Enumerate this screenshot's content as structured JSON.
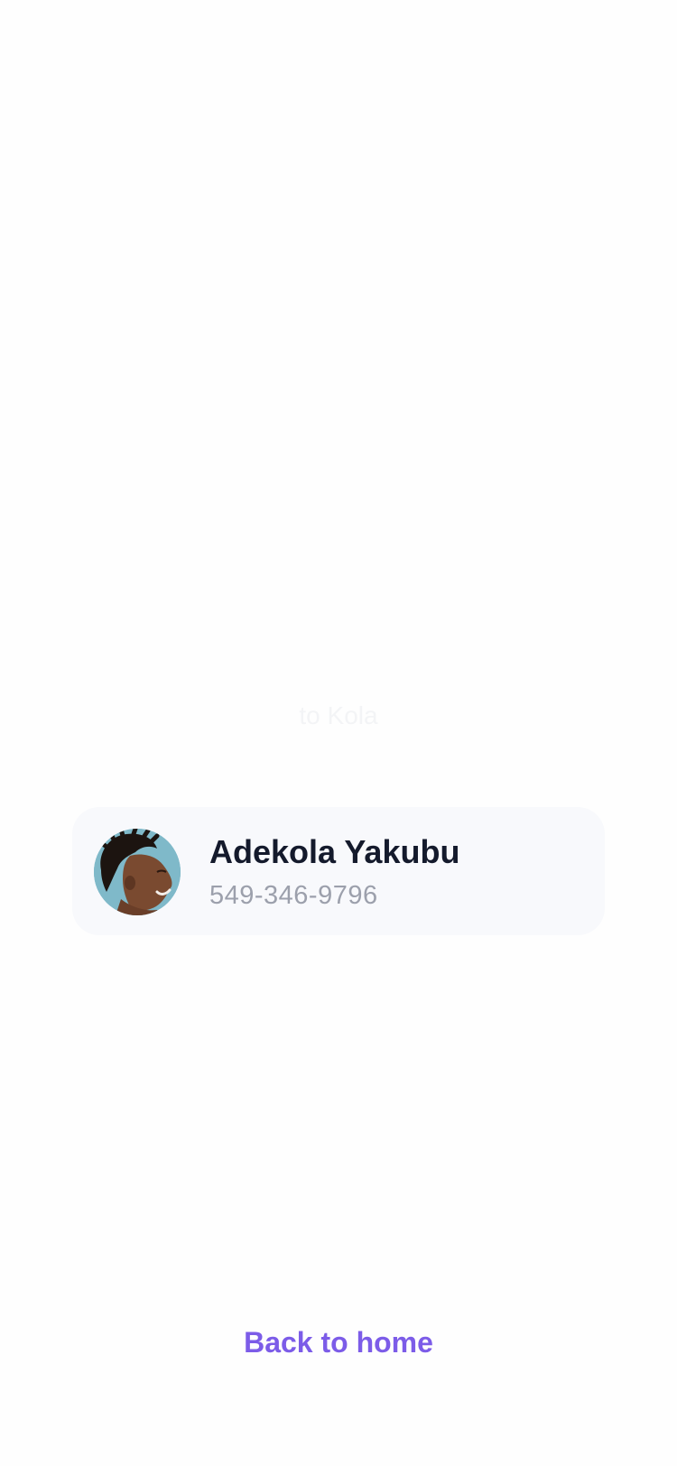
{
  "confirmation": {
    "subtitle": "to Kola"
  },
  "contact": {
    "name": "Adekola Yakubu",
    "phone": "549-346-9796",
    "avatar_icon": "person-avatar"
  },
  "actions": {
    "back_label": "Back to home"
  },
  "colors": {
    "accent": "#7c5ce8",
    "name_text": "#141a2c",
    "phone_text": "#9ca0ac",
    "card_background": "#f8f9fc",
    "avatar_background": "#7fb9c9"
  }
}
